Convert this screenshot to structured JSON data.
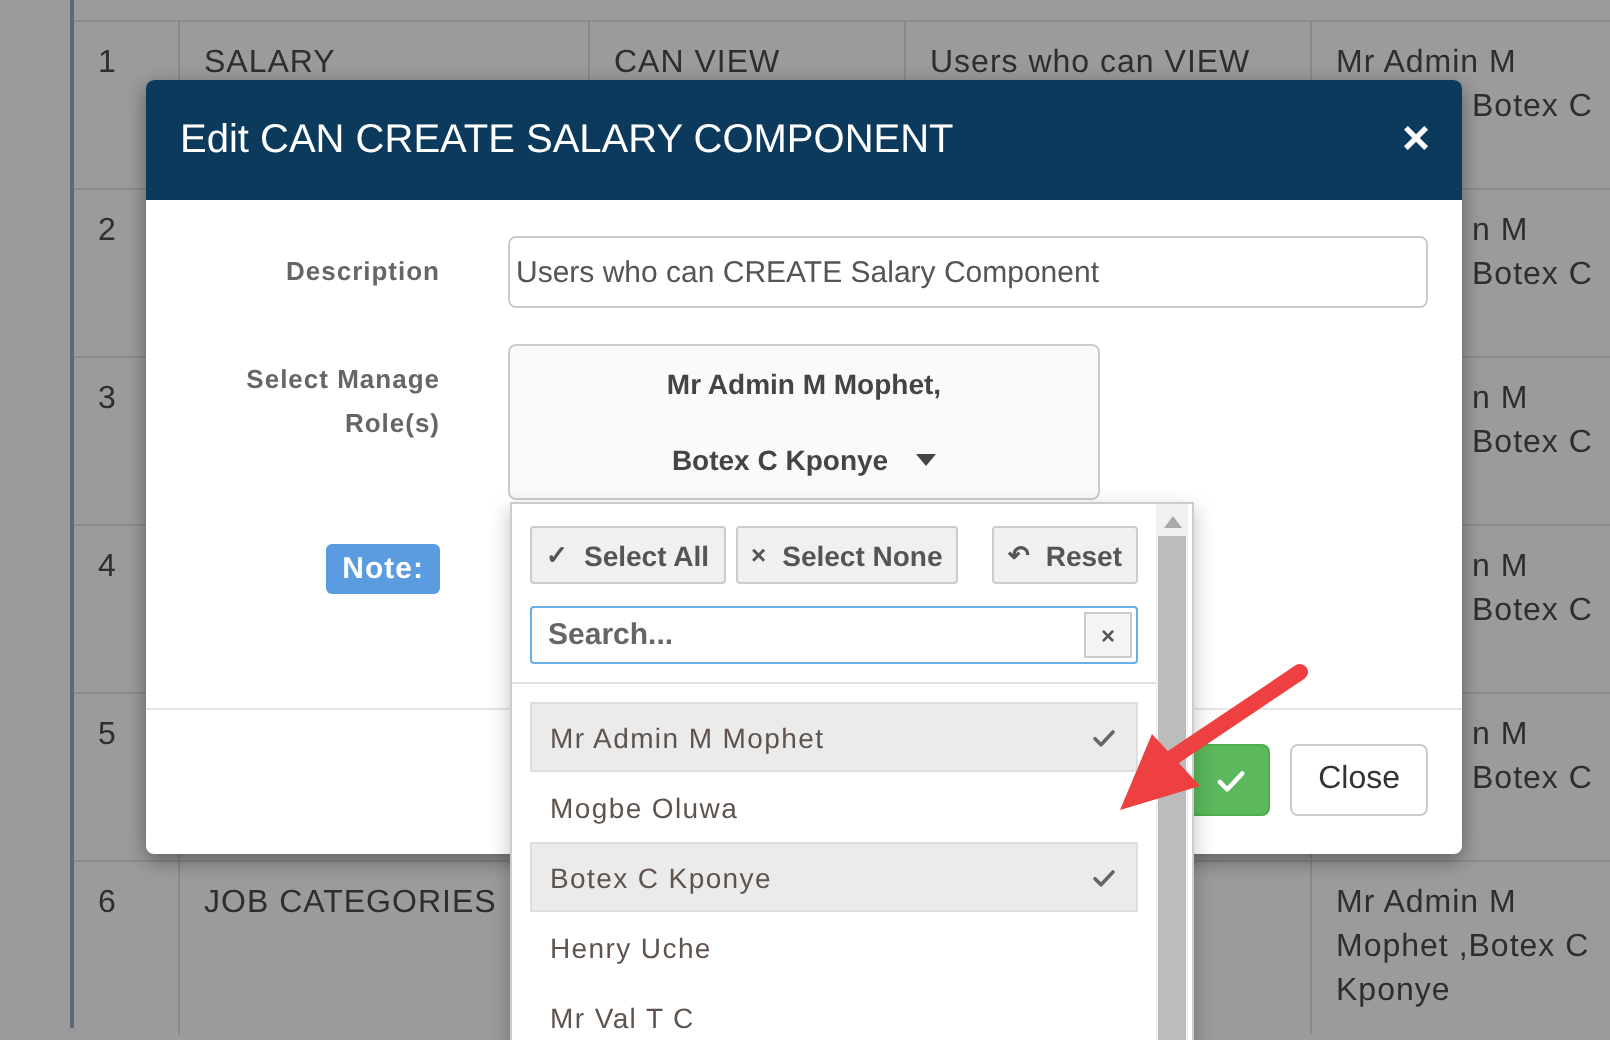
{
  "table": {
    "rows": [
      {
        "number": "1",
        "cells": [
          "SALARY",
          "CAN VIEW",
          "Users who can VIEW"
        ],
        "assigned": [
          {
            "text": "Mr Admin M"
          },
          {
            "text": "Botex C",
            "cut": true
          }
        ]
      },
      {
        "number": "2",
        "cells": [],
        "assigned": [
          {
            "text": "n M",
            "cut": true
          },
          {
            "text": "Botex C",
            "cut": true
          }
        ]
      },
      {
        "number": "3",
        "cells": [],
        "assigned": [
          {
            "text": "n M",
            "cut": true
          },
          {
            "text": "Botex C",
            "cut": true
          }
        ]
      },
      {
        "number": "4",
        "cells": [],
        "assigned": [
          {
            "text": "n M",
            "cut": true
          },
          {
            "text": "Botex C",
            "cut": true
          }
        ]
      },
      {
        "number": "5",
        "cells": [],
        "assigned": [
          {
            "text": "n M",
            "cut": true
          },
          {
            "text": "Botex C",
            "cut": true
          }
        ]
      },
      {
        "number": "6",
        "cells": [
          "JOB CATEGORIES"
        ],
        "assigned": [
          {
            "text": "Mr Admin M"
          },
          {
            "text": "Mophet ,Botex C"
          },
          {
            "text": "Kponye"
          }
        ]
      }
    ]
  },
  "modal": {
    "title": "Edit CAN CREATE SALARY COMPONENT",
    "close": "×",
    "description": {
      "label": "Description",
      "value": "Users who can CREATE Salary Component"
    },
    "roles": {
      "label": "Select Manage Role(s)",
      "summary": [
        "Mr Admin M Mophet,",
        "Botex C Kponye"
      ]
    },
    "note": "Note:",
    "close_button": "Close",
    "dropdown": {
      "actions": [
        {
          "icon": "✓",
          "label": "Select All"
        },
        {
          "icon": "×",
          "label": "Select None"
        },
        {
          "icon": "↶",
          "label": "Reset"
        }
      ],
      "search": {
        "placeholder": "Search...",
        "clear": "×"
      },
      "options": [
        {
          "label": "Mr Admin M Mophet",
          "selected": true
        },
        {
          "label": "Mogbe Oluwa",
          "selected": false
        },
        {
          "label": "Botex C Kponye",
          "selected": true
        },
        {
          "label": "Henry Uche",
          "selected": false
        },
        {
          "label": "Mr Val T C",
          "selected": false
        }
      ]
    }
  }
}
